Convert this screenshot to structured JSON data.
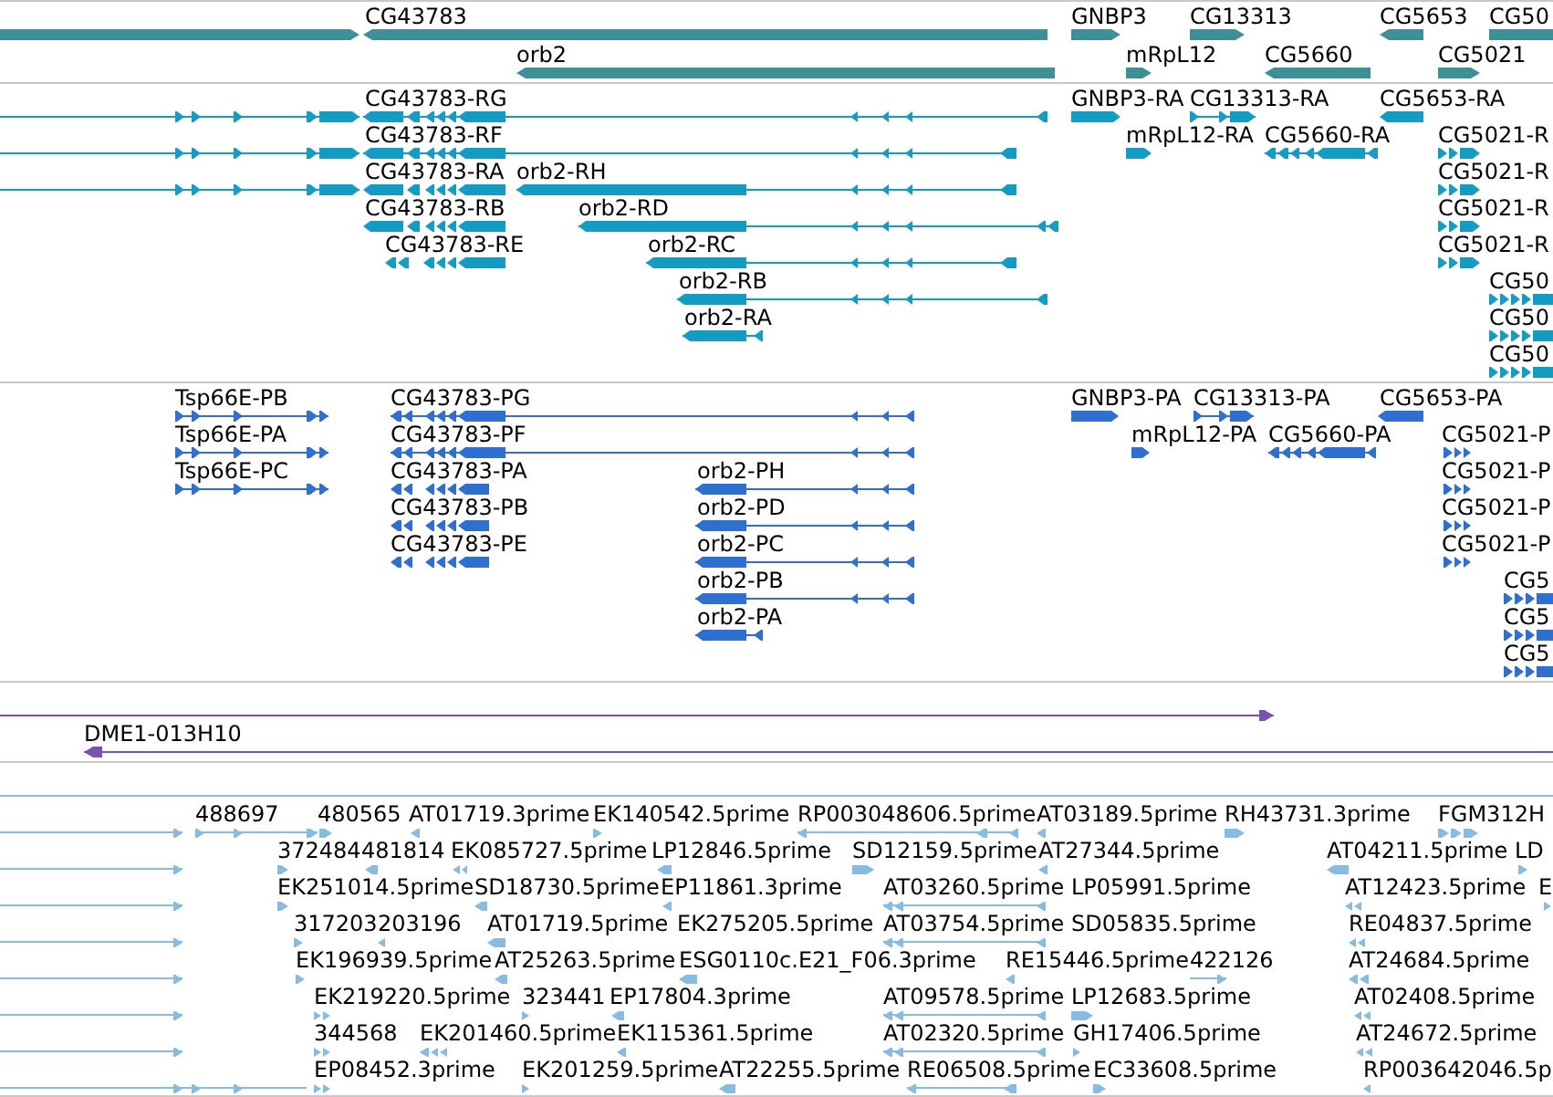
{
  "tracks": [
    {
      "color": "#3e8f96",
      "rows": [
        [
          {
            "reverse": false
          },
          {
            "label": "CG43783",
            "reverse": true
          },
          {
            "label": "GNBP3",
            "reverse": false
          },
          {
            "label": "CG13313",
            "reverse": false
          },
          {
            "label": "CG5653",
            "reverse": true
          },
          {
            "label": "CG50"
          }
        ],
        [
          {
            "label": "orb2",
            "reverse": true
          },
          {
            "label": "mRpL12",
            "reverse": false
          },
          {
            "label": "CG5660",
            "reverse": true
          },
          {
            "label": "CG5021",
            "reverse": false
          }
        ]
      ]
    },
    {
      "color": "#159cc4",
      "rows": [
        [
          {
            "reverse": false
          },
          {
            "label": "CG43783-RG",
            "reverse": true
          },
          {
            "label": "GNBP3-RA",
            "reverse": false
          },
          {
            "label": "CG13313-RA",
            "reverse": false
          },
          {
            "label": "CG5653-RA",
            "reverse": true
          }
        ],
        [
          {
            "reverse": false
          },
          {
            "label": "CG43783-RF",
            "reverse": true
          },
          {
            "label": "mRpL12-RA",
            "reverse": false
          },
          {
            "label": "CG5660-RA",
            "reverse": true
          },
          {
            "label": "CG5021-R",
            "reverse": false
          }
        ],
        [
          {
            "reverse": false
          },
          {
            "label": "CG43783-RA",
            "reverse": true
          },
          {
            "label": "orb2-RH",
            "reverse": true
          },
          {
            "label": "CG5021-R",
            "reverse": false
          }
        ],
        [
          {
            "label": "CG43783-RB",
            "reverse": true
          },
          {
            "label": "orb2-RD",
            "reverse": true
          },
          {
            "label": "CG5021-R",
            "reverse": false
          }
        ],
        [
          {
            "label": "CG43783-RE",
            "reverse": true
          },
          {
            "label": "orb2-RC",
            "reverse": true
          },
          {
            "label": "CG5021-R",
            "reverse": false
          }
        ],
        [
          {
            "label": "orb2-RB",
            "reverse": true
          },
          {
            "label": "CG50",
            "reverse": false
          }
        ],
        [
          {
            "label": "orb2-RA",
            "reverse": true
          },
          {
            "label": "CG50",
            "reverse": false
          }
        ],
        [
          {
            "label": "CG50",
            "reverse": false
          }
        ]
      ]
    },
    {
      "color": "#2f6fd0",
      "rows": [
        [
          {
            "label": "Tsp66E-PB",
            "reverse": false
          },
          {
            "label": "CG43783-PG",
            "reverse": true
          },
          {
            "label": "GNBP3-PA",
            "reverse": false
          },
          {
            "label": "CG13313-PA",
            "reverse": false
          },
          {
            "label": "CG5653-PA",
            "reverse": true
          }
        ],
        [
          {
            "label": "Tsp66E-PA",
            "reverse": false
          },
          {
            "label": "CG43783-PF",
            "reverse": true
          },
          {
            "label": "mRpL12-PA",
            "reverse": false
          },
          {
            "label": "CG5660-PA",
            "reverse": true
          },
          {
            "label": "CG5021-P",
            "reverse": false
          }
        ],
        [
          {
            "label": "Tsp66E-PC",
            "reverse": false
          },
          {
            "label": "CG43783-PA",
            "reverse": true
          },
          {
            "label": "orb2-PH",
            "reverse": true
          },
          {
            "label": "CG5021-P",
            "reverse": false
          }
        ],
        [
          {
            "label": "CG43783-PB",
            "reverse": true
          },
          {
            "label": "orb2-PD",
            "reverse": true
          },
          {
            "label": "CG5021-P",
            "reverse": false
          }
        ],
        [
          {
            "label": "CG43783-PE",
            "reverse": true
          },
          {
            "label": "orb2-PC",
            "reverse": true
          },
          {
            "label": "CG5021-P",
            "reverse": false
          }
        ],
        [
          {
            "label": "orb2-PB",
            "reverse": true
          },
          {
            "label": "CG5",
            "reverse": false
          }
        ],
        [
          {
            "label": "orb2-PA",
            "reverse": true
          },
          {
            "label": "CG5",
            "reverse": false
          }
        ],
        [
          {
            "label": "CG5",
            "reverse": false
          }
        ]
      ]
    },
    {
      "color": "#7853b4",
      "rows": [
        [
          {
            "reverse": false
          }
        ],
        [
          {
            "label": "DME1-013H10",
            "reverse": true
          }
        ]
      ]
    },
    {
      "color": "#86bce2",
      "rows": [
        [
          {}
        ],
        [
          {
            "reverse": false
          },
          {
            "label": "488697",
            "reverse": false
          },
          {
            "label": "480565",
            "reverse": false
          },
          {
            "label": "AT01719.3prime",
            "reverse": true
          },
          {
            "label": "EK140542.5prime",
            "reverse": false
          },
          {
            "label": "RP003048606.5prime",
            "reverse": true
          },
          {
            "label": "AT03189.5prime",
            "reverse": true
          },
          {
            "label": "RH43731.3prime",
            "reverse": false
          },
          {
            "label": "FGM312H",
            "reverse": false
          }
        ],
        [
          {
            "reverse": false
          },
          {
            "label": "372484",
            "reverse": false
          },
          {
            "label": "481814",
            "reverse": true
          },
          {
            "label": "EK085727.5prime",
            "reverse": true
          },
          {
            "label": "LP12846.5prime",
            "reverse": true
          },
          {
            "label": "SD12159.5prime",
            "reverse": false
          },
          {
            "label": "AT27344.5prime",
            "reverse": true
          },
          {
            "label": "AT04211.5prime",
            "reverse": true
          },
          {
            "label": "LD",
            "reverse": false
          }
        ],
        [
          {
            "reverse": false
          },
          {
            "label": "EK251014.5prime",
            "reverse": false
          },
          {
            "label": "SD18730.5prime",
            "reverse": true
          },
          {
            "label": "EP11861.3prime",
            "reverse": true
          },
          {
            "label": "AT03260.5prime",
            "reverse": true
          },
          {
            "label": "LP05991.5prime"
          },
          {
            "label": "AT12423.5prime",
            "reverse": true
          },
          {
            "label": "E",
            "reverse": false
          }
        ],
        [
          {
            "reverse": false
          },
          {
            "label": "317203",
            "reverse": false
          },
          {
            "label": "203196",
            "reverse": true
          },
          {
            "label": "AT01719.5prime",
            "reverse": true
          },
          {
            "label": "EK275205.5prime"
          },
          {
            "label": "AT03754.5prime",
            "reverse": true
          },
          {
            "label": "SD05835.5prime"
          },
          {
            "label": "RE04837.5prime",
            "reverse": true
          }
        ],
        [
          {
            "reverse": false
          },
          {
            "label": "EK196939.5prime",
            "reverse": false
          },
          {
            "label": "AT25263.5prime",
            "reverse": true
          },
          {
            "label": "ESG0110c.E21_F06.3prime",
            "reverse": true
          },
          {
            "label": "RE15446.5prime",
            "reverse": true
          },
          {
            "label": "422126",
            "reverse": false
          },
          {
            "label": "AT24684.5prime",
            "reverse": true
          }
        ],
        [
          {
            "reverse": false
          },
          {
            "label": "EK219220.5prime",
            "reverse": false
          },
          {
            "label": "323441",
            "reverse": false
          },
          {
            "label": "EP17804.3prime",
            "reverse": true
          },
          {
            "label": "AT09578.5prime",
            "reverse": true
          },
          {
            "label": "LP12683.5prime",
            "reverse": false
          },
          {
            "label": "AT02408.5prime",
            "reverse": true
          }
        ],
        [
          {
            "reverse": false
          },
          {
            "label": "344568",
            "reverse": false
          },
          {
            "label": "EK201460.5prime",
            "reverse": true
          },
          {
            "label": "EK115361.5prime",
            "reverse": true
          },
          {
            "label": "AT02320.5prime",
            "reverse": true
          },
          {
            "label": "GH17406.5prime",
            "reverse": false
          },
          {
            "label": "AT24672.5prime",
            "reverse": true
          }
        ],
        [
          {
            "reverse": false
          },
          {
            "label": "EP08452.3prime",
            "reverse": false
          },
          {
            "label": "EK201259.5prime",
            "reverse": false
          },
          {
            "label": "AT22255.5prime",
            "reverse": true
          },
          {
            "label": "RE06508.5prime",
            "reverse": true
          },
          {
            "label": "EC33608.5prime",
            "reverse": false
          },
          {
            "label": "RP003642046.5p",
            "reverse": true
          }
        ]
      ]
    }
  ]
}
